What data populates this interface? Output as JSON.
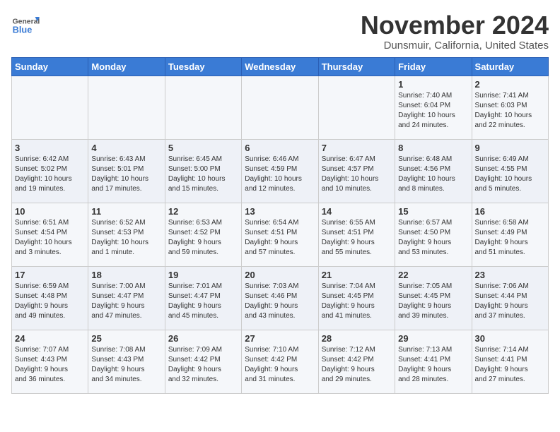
{
  "header": {
    "logo_line1": "General",
    "logo_line2": "Blue",
    "month": "November 2024",
    "location": "Dunsmuir, California, United States"
  },
  "weekdays": [
    "Sunday",
    "Monday",
    "Tuesday",
    "Wednesday",
    "Thursday",
    "Friday",
    "Saturday"
  ],
  "weeks": [
    [
      {
        "day": "",
        "info": ""
      },
      {
        "day": "",
        "info": ""
      },
      {
        "day": "",
        "info": ""
      },
      {
        "day": "",
        "info": ""
      },
      {
        "day": "",
        "info": ""
      },
      {
        "day": "1",
        "info": "Sunrise: 7:40 AM\nSunset: 6:04 PM\nDaylight: 10 hours\nand 24 minutes."
      },
      {
        "day": "2",
        "info": "Sunrise: 7:41 AM\nSunset: 6:03 PM\nDaylight: 10 hours\nand 22 minutes."
      }
    ],
    [
      {
        "day": "3",
        "info": "Sunrise: 6:42 AM\nSunset: 5:02 PM\nDaylight: 10 hours\nand 19 minutes."
      },
      {
        "day": "4",
        "info": "Sunrise: 6:43 AM\nSunset: 5:01 PM\nDaylight: 10 hours\nand 17 minutes."
      },
      {
        "day": "5",
        "info": "Sunrise: 6:45 AM\nSunset: 5:00 PM\nDaylight: 10 hours\nand 15 minutes."
      },
      {
        "day": "6",
        "info": "Sunrise: 6:46 AM\nSunset: 4:59 PM\nDaylight: 10 hours\nand 12 minutes."
      },
      {
        "day": "7",
        "info": "Sunrise: 6:47 AM\nSunset: 4:57 PM\nDaylight: 10 hours\nand 10 minutes."
      },
      {
        "day": "8",
        "info": "Sunrise: 6:48 AM\nSunset: 4:56 PM\nDaylight: 10 hours\nand 8 minutes."
      },
      {
        "day": "9",
        "info": "Sunrise: 6:49 AM\nSunset: 4:55 PM\nDaylight: 10 hours\nand 5 minutes."
      }
    ],
    [
      {
        "day": "10",
        "info": "Sunrise: 6:51 AM\nSunset: 4:54 PM\nDaylight: 10 hours\nand 3 minutes."
      },
      {
        "day": "11",
        "info": "Sunrise: 6:52 AM\nSunset: 4:53 PM\nDaylight: 10 hours\nand 1 minute."
      },
      {
        "day": "12",
        "info": "Sunrise: 6:53 AM\nSunset: 4:52 PM\nDaylight: 9 hours\nand 59 minutes."
      },
      {
        "day": "13",
        "info": "Sunrise: 6:54 AM\nSunset: 4:51 PM\nDaylight: 9 hours\nand 57 minutes."
      },
      {
        "day": "14",
        "info": "Sunrise: 6:55 AM\nSunset: 4:51 PM\nDaylight: 9 hours\nand 55 minutes."
      },
      {
        "day": "15",
        "info": "Sunrise: 6:57 AM\nSunset: 4:50 PM\nDaylight: 9 hours\nand 53 minutes."
      },
      {
        "day": "16",
        "info": "Sunrise: 6:58 AM\nSunset: 4:49 PM\nDaylight: 9 hours\nand 51 minutes."
      }
    ],
    [
      {
        "day": "17",
        "info": "Sunrise: 6:59 AM\nSunset: 4:48 PM\nDaylight: 9 hours\nand 49 minutes."
      },
      {
        "day": "18",
        "info": "Sunrise: 7:00 AM\nSunset: 4:47 PM\nDaylight: 9 hours\nand 47 minutes."
      },
      {
        "day": "19",
        "info": "Sunrise: 7:01 AM\nSunset: 4:47 PM\nDaylight: 9 hours\nand 45 minutes."
      },
      {
        "day": "20",
        "info": "Sunrise: 7:03 AM\nSunset: 4:46 PM\nDaylight: 9 hours\nand 43 minutes."
      },
      {
        "day": "21",
        "info": "Sunrise: 7:04 AM\nSunset: 4:45 PM\nDaylight: 9 hours\nand 41 minutes."
      },
      {
        "day": "22",
        "info": "Sunrise: 7:05 AM\nSunset: 4:45 PM\nDaylight: 9 hours\nand 39 minutes."
      },
      {
        "day": "23",
        "info": "Sunrise: 7:06 AM\nSunset: 4:44 PM\nDaylight: 9 hours\nand 37 minutes."
      }
    ],
    [
      {
        "day": "24",
        "info": "Sunrise: 7:07 AM\nSunset: 4:43 PM\nDaylight: 9 hours\nand 36 minutes."
      },
      {
        "day": "25",
        "info": "Sunrise: 7:08 AM\nSunset: 4:43 PM\nDaylight: 9 hours\nand 34 minutes."
      },
      {
        "day": "26",
        "info": "Sunrise: 7:09 AM\nSunset: 4:42 PM\nDaylight: 9 hours\nand 32 minutes."
      },
      {
        "day": "27",
        "info": "Sunrise: 7:10 AM\nSunset: 4:42 PM\nDaylight: 9 hours\nand 31 minutes."
      },
      {
        "day": "28",
        "info": "Sunrise: 7:12 AM\nSunset: 4:42 PM\nDaylight: 9 hours\nand 29 minutes."
      },
      {
        "day": "29",
        "info": "Sunrise: 7:13 AM\nSunset: 4:41 PM\nDaylight: 9 hours\nand 28 minutes."
      },
      {
        "day": "30",
        "info": "Sunrise: 7:14 AM\nSunset: 4:41 PM\nDaylight: 9 hours\nand 27 minutes."
      }
    ]
  ]
}
